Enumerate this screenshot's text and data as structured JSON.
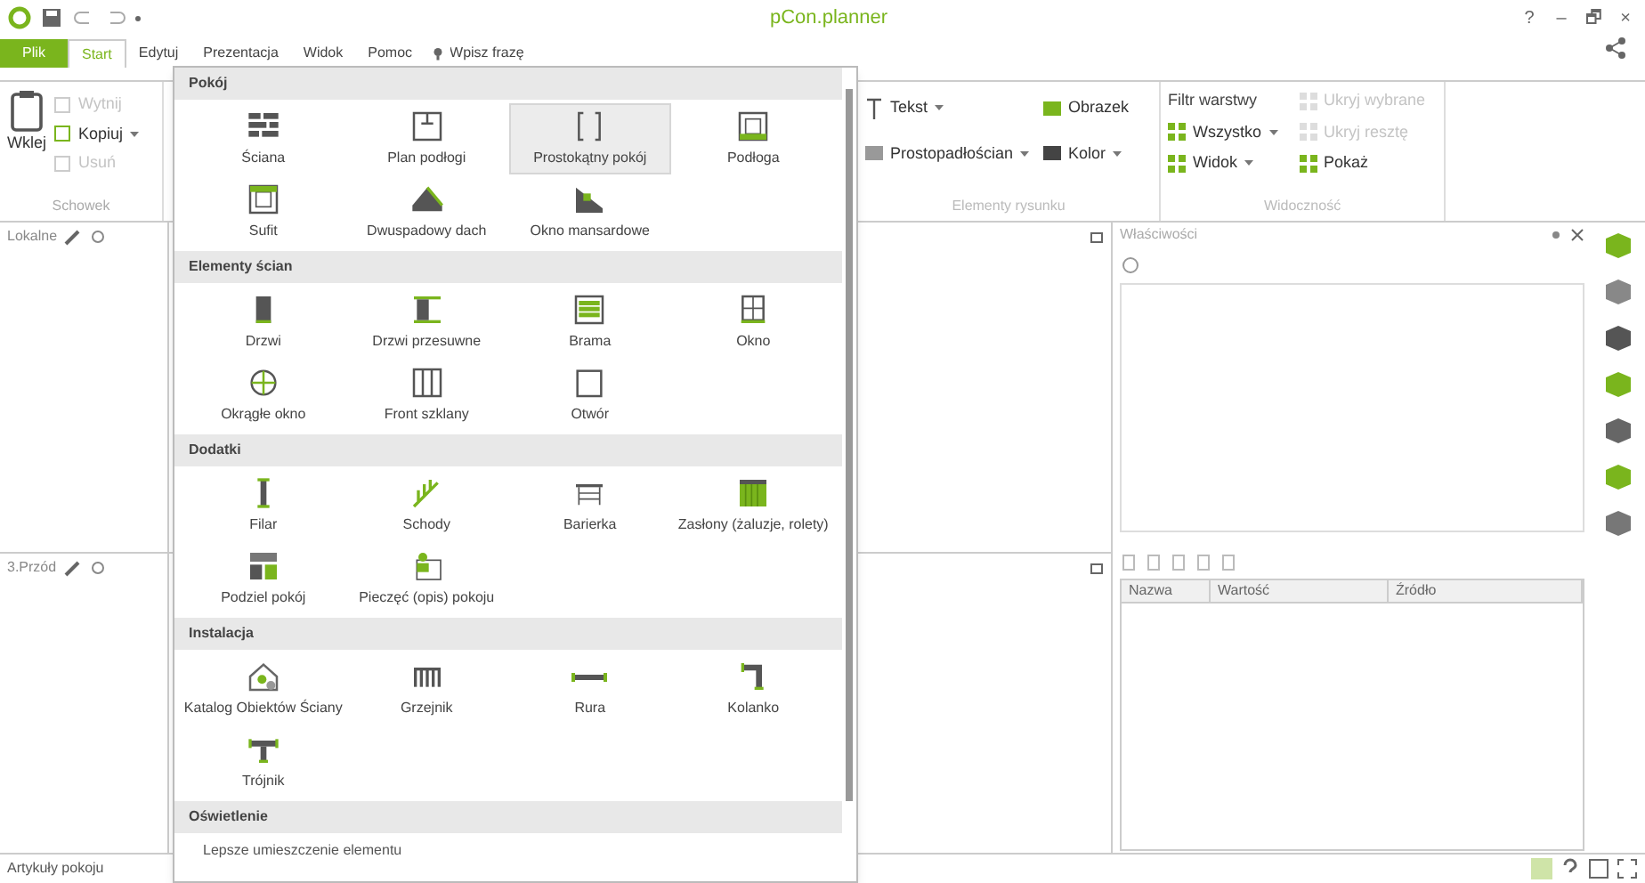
{
  "window": {
    "title": "pCon.planner",
    "controls": [
      "?",
      "–",
      "🗗",
      "×"
    ]
  },
  "tabs": [
    {
      "label": "Plik",
      "kind": "file",
      "selected": false
    },
    {
      "label": "Start",
      "kind": "tab",
      "selected": true
    },
    {
      "label": "Edytuj",
      "kind": "tab",
      "selected": false
    },
    {
      "label": "Prezentacja",
      "kind": "tab",
      "selected": false
    },
    {
      "label": "Widok",
      "kind": "tab",
      "selected": false
    },
    {
      "label": "Pomoc",
      "kind": "tab",
      "selected": false
    }
  ],
  "search": {
    "placeholder": "Wpisz frazę"
  },
  "clipboard": {
    "paste": "Wklej",
    "actions": [
      {
        "label": "Wytnij",
        "disabled": true
      },
      {
        "label": "Kopiuj",
        "disabled": false
      },
      {
        "label": "Usuń",
        "disabled": true
      }
    ],
    "group_label": "Schowek"
  },
  "drawing_group": {
    "actions": [
      {
        "label": "Tekst",
        "disabled": false
      },
      {
        "label": "Obrazek",
        "disabled": false
      },
      {
        "label": "Prostopadłościan",
        "disabled": false
      },
      {
        "label": "Kolor",
        "disabled": false
      }
    ],
    "group_label": "Elementy rysunku"
  },
  "visibility_group": {
    "title": "Filtr warstwy",
    "actions": [
      {
        "label": "Ukryj wybrane",
        "disabled": true
      },
      {
        "label": "Wszystko",
        "disabled": false
      },
      {
        "label": "Ukryj resztę",
        "disabled": true
      },
      {
        "label": "Widok",
        "disabled": false
      },
      {
        "label": "Pokaż",
        "disabled": false
      }
    ],
    "group_label": "Widoczność"
  },
  "gallery": {
    "sections": [
      {
        "title": "Pokój",
        "items": [
          {
            "label": "Ściana",
            "selected": false
          },
          {
            "label": "Plan podłogi",
            "selected": false
          },
          {
            "label": "Prostokątny pokój",
            "selected": true
          },
          {
            "label": "Podłoga",
            "selected": false
          },
          {
            "label": "Sufit",
            "selected": false
          },
          {
            "label": "Dwuspadowy dach",
            "selected": false
          },
          {
            "label": "Okno mansardowe",
            "selected": false
          }
        ]
      },
      {
        "title": "Elementy ścian",
        "items": [
          {
            "label": "Drzwi",
            "selected": false
          },
          {
            "label": "Drzwi przesuwne",
            "selected": false
          },
          {
            "label": "Brama",
            "selected": false
          },
          {
            "label": "Okno",
            "selected": false
          },
          {
            "label": "Okrągłe okno",
            "selected": false
          },
          {
            "label": "Front szklany",
            "selected": false
          },
          {
            "label": "Otwór",
            "selected": false
          }
        ]
      },
      {
        "title": "Dodatki",
        "items": [
          {
            "label": "Filar",
            "selected": false
          },
          {
            "label": "Schody",
            "selected": false
          },
          {
            "label": "Barierka",
            "selected": false
          },
          {
            "label": "Zasłony (żaluzje, rolety)",
            "selected": false
          },
          {
            "label": "Podziel pokój",
            "selected": false
          },
          {
            "label": "Pieczęć (opis) pokoju",
            "selected": false
          }
        ]
      },
      {
        "title": "Instalacja",
        "items": [
          {
            "label": "Katalog Obiektów Ściany",
            "selected": false
          },
          {
            "label": "Grzejnik",
            "selected": false
          },
          {
            "label": "Rura",
            "selected": false
          },
          {
            "label": "Kolanko",
            "selected": false
          },
          {
            "label": "Trójnik",
            "selected": false
          }
        ]
      },
      {
        "title": "Oświetlenie"
      }
    ],
    "footer_option": "Lepsze umieszczenie elementu"
  },
  "viewports": [
    {
      "label": "Lokalne"
    },
    {
      "label": "3.Przód"
    }
  ],
  "properties": {
    "title": "Właściwości",
    "columns": [
      "Nazwa",
      "Wartość",
      "Źródło"
    ]
  },
  "status_bar": {
    "text": "Artykuły pokoju"
  }
}
